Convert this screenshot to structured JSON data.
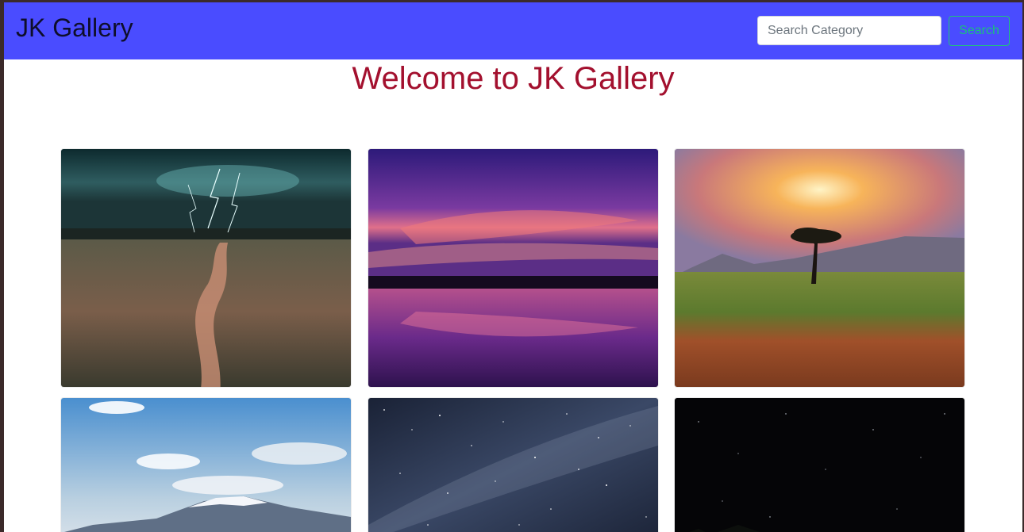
{
  "navbar": {
    "brand": "JK Gallery",
    "search": {
      "placeholder": "Search Category",
      "value": ""
    },
    "search_button_label": "Search",
    "background_color": "#4a4cff"
  },
  "main": {
    "heading": "Welcome to JK Gallery",
    "heading_color": "#a3102e"
  },
  "gallery": {
    "images": [
      {
        "name": "storm-field-image"
      },
      {
        "name": "purple-sunset-lake-image"
      },
      {
        "name": "savanna-sunset-tree-image"
      },
      {
        "name": "snowy-mountain-clouds-image"
      },
      {
        "name": "starry-night-sky-image"
      },
      {
        "name": "dark-night-sky-image"
      }
    ]
  }
}
